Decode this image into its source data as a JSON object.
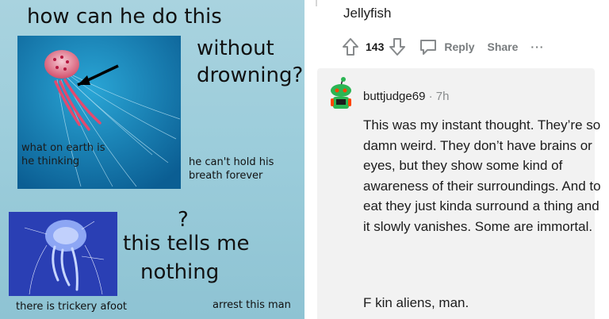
{
  "meme": {
    "title": "how can he do this",
    "without": "without",
    "drowning": "drowning?",
    "thinking": "what on earth is he thinking",
    "breath": "he can't hold his breath forever",
    "question_mark": "?",
    "tells": "this tells me",
    "nothing": "nothing",
    "trickery": "there is trickery afoot",
    "arrest": "arrest this man"
  },
  "thread": {
    "parent_text": "Jellyfish",
    "vote_count": "143",
    "reply_label": "Reply",
    "share_label": "Share",
    "more_label": "···"
  },
  "comment": {
    "author": "buttjudge69",
    "meta": " · 7h",
    "body": "This was my instant thought. They’re so damn weird. They don’t have brains or eyes, but they show some kind of awareness of their surroundings. And to eat they just kinda surround a thing and it slowly vanishes. Some are immortal.",
    "sign_off": "F⁠  ⁠kin aliens, man."
  },
  "colors": {
    "meme_bg": "#9ccddb",
    "comment_bg": "#f2f2f2",
    "meta_gray": "#878a8c",
    "action_gray": "#787c7e",
    "avatar_green": "#2bb553"
  }
}
